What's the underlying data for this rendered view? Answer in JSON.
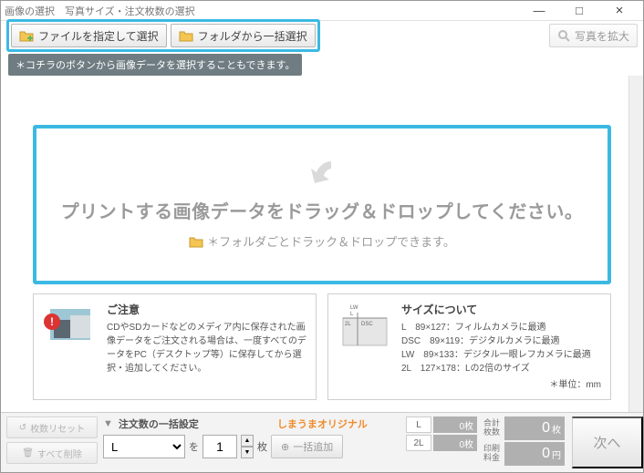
{
  "window": {
    "title": "画像の選択　写真サイズ・注文枚数の選択",
    "minimize": "—",
    "maximize": "□",
    "close": "×"
  },
  "toolbar": {
    "select_file": "ファイルを指定して選択",
    "select_folder": "フォルダから一括選択",
    "zoom": "写真を拡大"
  },
  "tip": "＊コチラのボタンから画像データを選択することもできます。",
  "drop": {
    "main": "プリントする画像データをドラッグ＆ドロップしてください。",
    "sub": "＊フォルダごとドラック＆ドロップできます。"
  },
  "caution": {
    "title": "ご注意",
    "body": "CDやSDカードなどのメディア内に保存された画像データをご注文される場合は、一度すべてのデータをPC（デスクトップ等）に保存してから選択・追加してください。"
  },
  "sizes": {
    "title": "サイズについて",
    "diag": {
      "lw": "LW",
      "l": "L",
      "2l": "2L",
      "dsc": "DSC"
    },
    "rows": [
      {
        "k": "L",
        "dim": "89×127",
        "desc": "：フィルムカメラに最適"
      },
      {
        "k": "DSC",
        "dim": "89×119",
        "desc": "：デジタルカメラに最適"
      },
      {
        "k": "LW",
        "dim": "89×133",
        "desc": "：デジタル一眼レフカメラに最適"
      },
      {
        "k": "2L",
        "dim": "127×178",
        "desc": "：Lの2倍のサイズ"
      }
    ],
    "unit_note": "＊単位：mm"
  },
  "bottom": {
    "reset": "枚数リセット",
    "delete_all": "すべて削除",
    "bulk_title": "注文数の一括設定",
    "brand": "しまうまオリジナル",
    "size_value": "L",
    "wo": "を",
    "qty": "1",
    "mai": "枚",
    "add": "一括追加",
    "counts": {
      "l_label": "L",
      "l_val": "0枚",
      "tl_label": "2L",
      "tl_val": "0枚",
      "sum_count_label": "合計\n枚数",
      "sum_count_val": "0",
      "sum_count_unit": "枚",
      "print_fee_label": "印刷\n料金",
      "print_fee_val": "0",
      "print_fee_unit": "円"
    },
    "next": "次へ"
  }
}
